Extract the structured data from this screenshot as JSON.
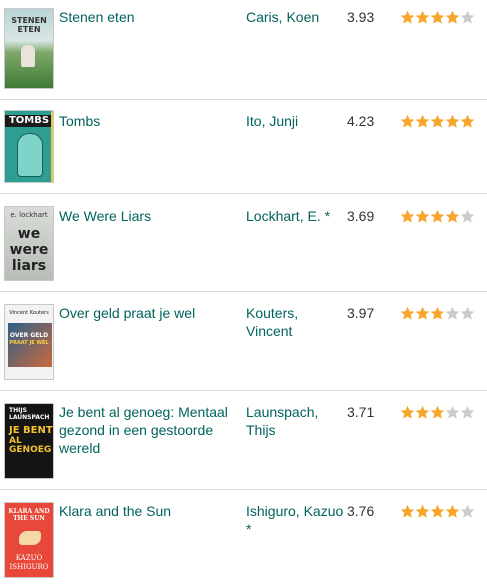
{
  "colors": {
    "link": "#00635d",
    "star_on": "#f6a62c",
    "star_off": "#cccccc",
    "divider": "#dcdcdc"
  },
  "books": [
    {
      "title": "Stenen eten",
      "author": "Caris, Koen",
      "avg_rating": "3.93",
      "stars": 4,
      "cover": {
        "text_lines": [
          "STENEN",
          "ETEN"
        ],
        "icon": "book-cover-field"
      }
    },
    {
      "title": "Tombs",
      "author": "Ito, Junji",
      "avg_rating": "4.23",
      "stars": 5,
      "cover": {
        "text_lines": [
          "TOMBS"
        ],
        "icon": "book-cover-manga"
      }
    },
    {
      "title": "We Were Liars",
      "author": "Lockhart, E. *",
      "avg_rating": "3.69",
      "stars": 4,
      "cover": {
        "text_lines": [
          "e. lockhart",
          "we",
          "were",
          "liars"
        ],
        "icon": "book-cover-typographic"
      }
    },
    {
      "title": "Over geld praat je wel",
      "author": "Kouters, Vincent",
      "avg_rating": "3.97",
      "stars": 3,
      "cover": {
        "text_lines": [
          "Vincent Kouters",
          "OVER GELD",
          "PRAAT JE WEL"
        ],
        "icon": "book-cover-photo"
      }
    },
    {
      "title": "Je bent al genoeg: Mentaal gezond in een gestoorde wereld",
      "author": "Launspach, Thijs",
      "avg_rating": "3.71",
      "stars": 3,
      "cover": {
        "text_lines": [
          "THIJS",
          "LAUNSPACH",
          "JE BENT",
          "AL GENOEG"
        ],
        "icon": "book-cover-bold-type"
      }
    },
    {
      "title": "Klara and the Sun",
      "author": "Ishiguro, Kazuo *",
      "avg_rating": "3.76",
      "stars": 4,
      "cover": {
        "text_lines": [
          "KLARA AND",
          "THE SUN",
          "KAZUO",
          "ISHIGURO"
        ],
        "icon": "book-cover-red"
      }
    }
  ]
}
